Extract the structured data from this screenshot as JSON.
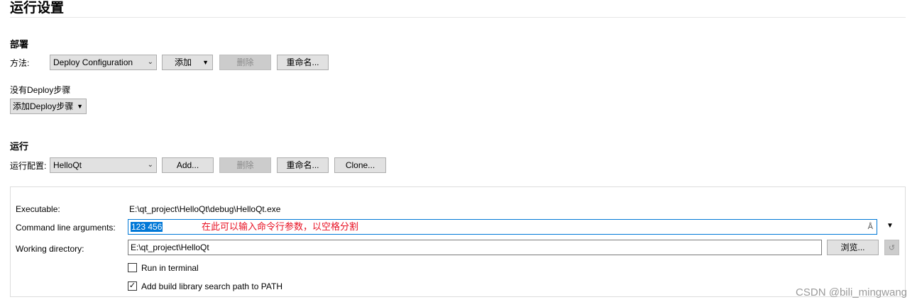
{
  "page_title": "运行设置",
  "deploy": {
    "section_title": "部署",
    "method_label": "方法:",
    "method_value": "Deploy Configuration",
    "add_label": "添加",
    "delete_label": "删除",
    "rename_label": "重命名...",
    "no_steps_text": "没有Deploy步骤",
    "add_step_label": "添加Deploy步骤"
  },
  "run": {
    "section_title": "运行",
    "config_label": "运行配置:",
    "config_value": "HelloQt",
    "add_label": "Add...",
    "delete_label": "删除",
    "rename_label": "重命名...",
    "clone_label": "Clone..."
  },
  "details": {
    "executable_label": "Executable:",
    "executable_value": "E:\\qt_project\\HelloQt\\debug\\HelloQt.exe",
    "args_label": "Command line arguments:",
    "args_value": "123 456",
    "args_annotation": "在此可以输入命令行参数，以空格分割",
    "workdir_label": "Working directory:",
    "workdir_value": "E:\\qt_project\\HelloQt",
    "browse_label": "浏览...",
    "run_in_terminal_label": "Run in terminal",
    "run_in_terminal_checked": false,
    "add_build_lib_label": "Add build library search path to PATH",
    "add_build_lib_checked": true
  },
  "watermark": "CSDN @bili_mingwang"
}
